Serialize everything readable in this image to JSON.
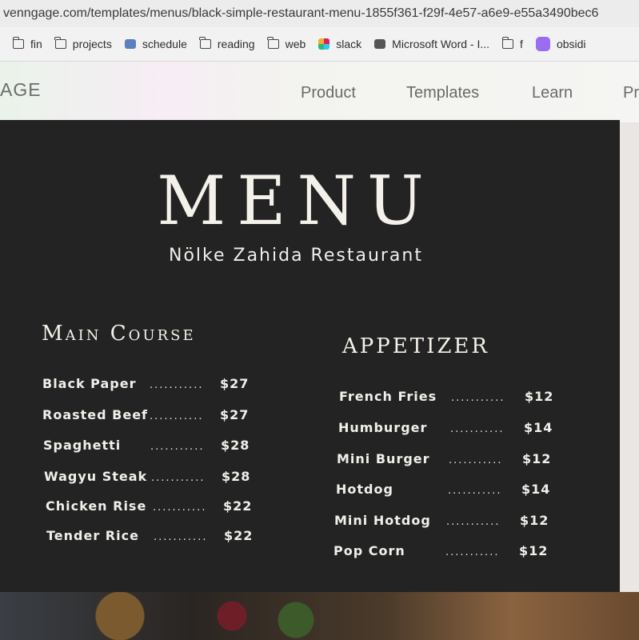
{
  "browser": {
    "url": "venngage.com/templates/menus/black-simple-restaurant-menu-1855f361-f29f-4e57-a6e9-e55a3490bec6",
    "bookmarks": [
      {
        "label": "fin",
        "icon": "folder-icon"
      },
      {
        "label": "projects",
        "icon": "folder-icon"
      },
      {
        "label": "schedule",
        "icon": "schedule-icon"
      },
      {
        "label": "reading",
        "icon": "folder-icon"
      },
      {
        "label": "web",
        "icon": "folder-icon"
      },
      {
        "label": "slack",
        "icon": "slack-icon"
      },
      {
        "label": "Microsoft Word - I...",
        "icon": "word-icon"
      },
      {
        "label": "f",
        "icon": "folder-icon"
      },
      {
        "label": "obsidi",
        "icon": "obsidian-icon"
      }
    ]
  },
  "site": {
    "logo": "AGE",
    "nav": [
      "Product",
      "Templates",
      "Learn",
      "Pr"
    ]
  },
  "menu": {
    "title": "MENU",
    "restaurant": "Nölke Zahida Restaurant",
    "dots": "...........",
    "main_course": {
      "heading": "Main Course",
      "items": [
        {
          "name": "Black Paper",
          "price": "$27"
        },
        {
          "name": "Roasted Beef",
          "price": "$27"
        },
        {
          "name": "Spaghetti",
          "price": "$28"
        },
        {
          "name": "Wagyu Steak",
          "price": "$28"
        },
        {
          "name": "Chicken Rise",
          "price": "$22"
        },
        {
          "name": "Tender Rice",
          "price": "$22"
        }
      ]
    },
    "appetizer": {
      "heading": "APPETIZER",
      "items": [
        {
          "name": "French Fries",
          "price": "$12"
        },
        {
          "name": "Humburger",
          "price": "$14"
        },
        {
          "name": "Mini Burger",
          "price": "$12"
        },
        {
          "name": "Hotdog",
          "price": "$14"
        },
        {
          "name": "Mini Hotdog",
          "price": "$12"
        },
        {
          "name": "Pop Corn",
          "price": "$12"
        }
      ]
    }
  }
}
